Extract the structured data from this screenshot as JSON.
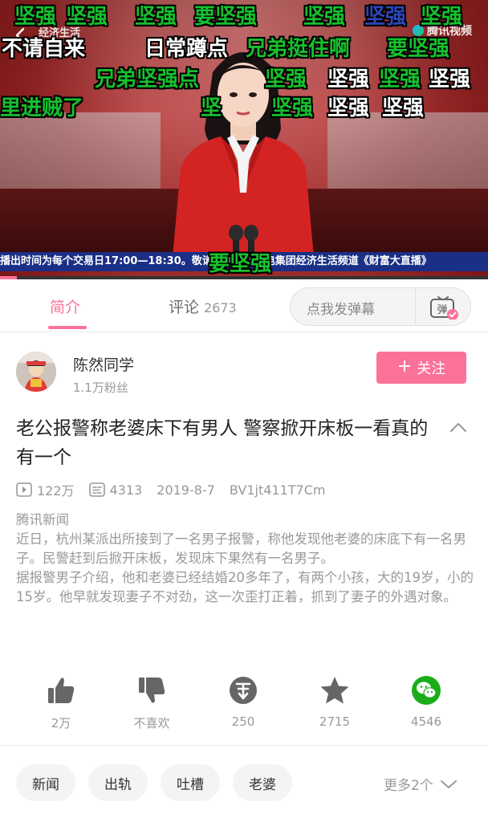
{
  "video": {
    "channel_logo": "经济生活",
    "platform_logo": "腾讯视频",
    "ticker": "播出时间为每个交易日17:00—18:30。敬请关注浙江广电集团经济生活频道《财富大直播》",
    "progress": 0.035,
    "danmaku": [
      {
        "text": "坚强",
        "color": "green"
      },
      {
        "text": "坚强",
        "color": "green"
      },
      {
        "text": "坚强",
        "color": "green"
      },
      {
        "text": "要坚强",
        "color": "green"
      },
      {
        "text": "坚强",
        "color": "green"
      },
      {
        "text": "坚强",
        "color": "blue"
      },
      {
        "text": "坚强",
        "color": "green"
      },
      {
        "text": "不请自来",
        "color": "white"
      },
      {
        "text": "日常蹲点",
        "color": "white"
      },
      {
        "text": "兄弟挺住啊",
        "color": "green"
      },
      {
        "text": "要坚强",
        "color": "green"
      },
      {
        "text": "兄弟坚强点",
        "color": "green"
      },
      {
        "text": "坚强",
        "color": "green"
      },
      {
        "text": "坚强",
        "color": "white"
      },
      {
        "text": "坚强",
        "color": "green"
      },
      {
        "text": "坚强",
        "color": "white"
      },
      {
        "text": "里进贼了",
        "color": "green"
      },
      {
        "text": "坚",
        "color": "green"
      },
      {
        "text": "坚强",
        "color": "green"
      },
      {
        "text": "坚强",
        "color": "white"
      },
      {
        "text": "坚强",
        "color": "white"
      },
      {
        "text": "要坚强",
        "color": "green"
      }
    ]
  },
  "tabs": {
    "intro": "简介",
    "comments": "评论",
    "comments_count": "2673",
    "danmu_placeholder": "点我发弹幕",
    "danmu_icon_label": "弹"
  },
  "uploader": {
    "name": "陈然同学",
    "fans": "1.1万粉丝",
    "follow_plus": "+",
    "follow_label": "关注"
  },
  "video_info": {
    "title": "老公报警称老婆床下有男人 警察掀开床板一看真的有一个",
    "views": "122万",
    "danmaku_count": "4313",
    "date": "2019-8-7",
    "bvid": "BV1jt411T7Cm",
    "source": "腾讯新闻",
    "paragraphs": [
      "近日，杭州某派出所接到了一名男子报警，称他发现他老婆的床底下有一名男子。民警赶到后掀开床板，发现床下果然有一名男子。",
      "据报警男子介绍，他和老婆已经结婚20多年了，有两个小孩，大的19岁，小的15岁。他早就发现妻子不对劲，这一次歪打正着，抓到了妻子的外遇对象。"
    ]
  },
  "actions": {
    "like": "2万",
    "dislike": "不喜欢",
    "coin": "250",
    "favorite": "2715",
    "share": "4546"
  },
  "tags": {
    "items": [
      "新闻",
      "出轨",
      "吐槽",
      "老婆"
    ],
    "more": "更多2个"
  },
  "colors": {
    "accent": "#fb7299",
    "danmaku_green": "#16c02e",
    "danmaku_blue": "#2d45b6",
    "wechat_green": "#1aad19"
  },
  "icons": {
    "back": "chevron-left-icon",
    "collapse": "chevron-up-icon",
    "views": "play-icon",
    "danmaku": "danmaku-list-icon",
    "like": "thumbs-up-icon",
    "dislike": "thumbs-down-icon",
    "coin": "coin-icon",
    "favorite": "star-icon",
    "share": "wechat-icon",
    "more": "chevron-down-icon"
  }
}
